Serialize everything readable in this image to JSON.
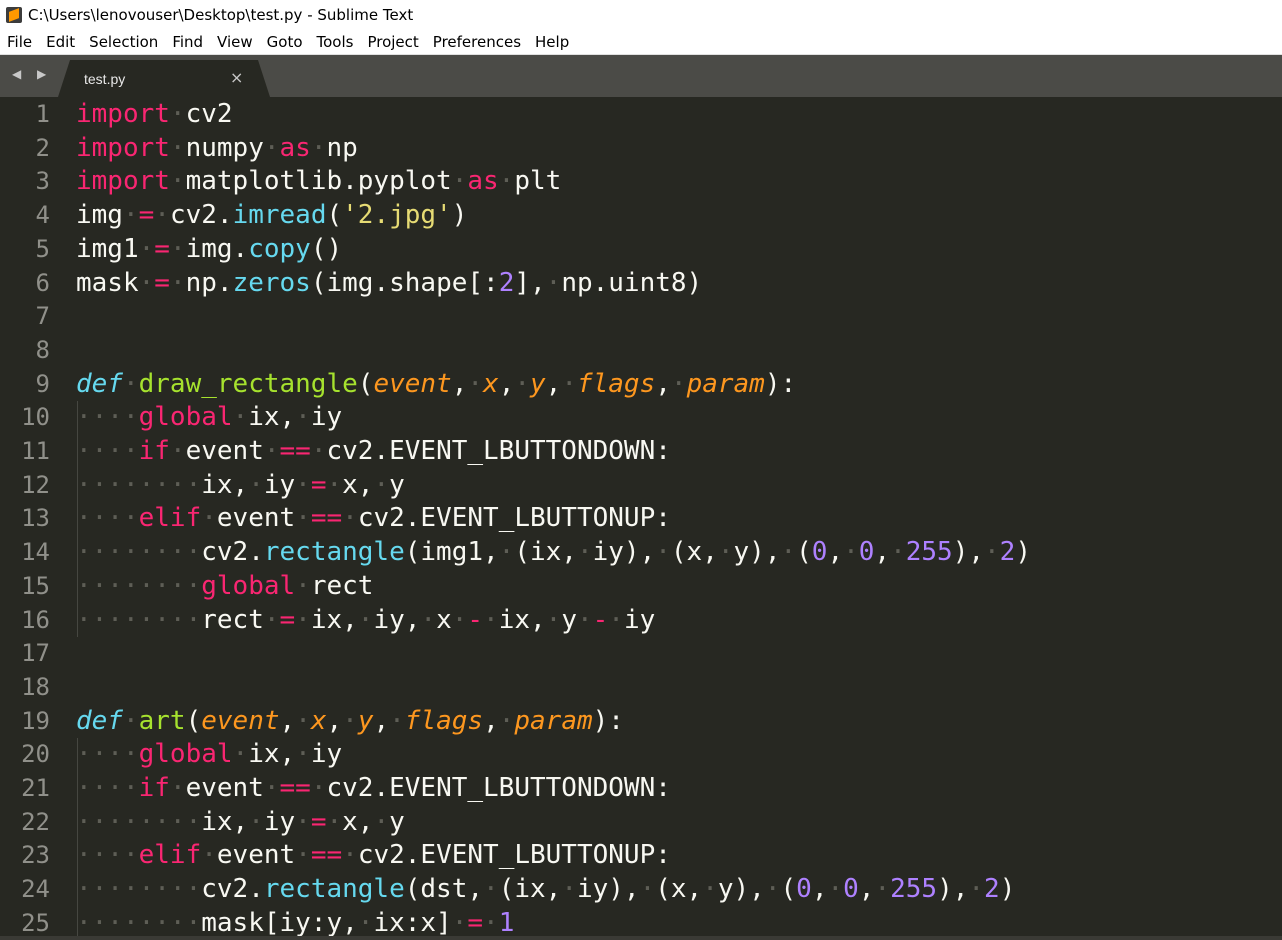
{
  "window": {
    "title": "C:\\Users\\lenovouser\\Desktop\\test.py - Sublime Text"
  },
  "menu": [
    "File",
    "Edit",
    "Selection",
    "Find",
    "View",
    "Goto",
    "Tools",
    "Project",
    "Preferences",
    "Help"
  ],
  "tab": {
    "label": "test.py",
    "close": "×",
    "nav": "◀ ▶"
  },
  "colors": {
    "background": "#272822",
    "keyword": "#f92672",
    "function": "#66d9ef",
    "name": "#a6e22e",
    "parameter": "#fd971f",
    "number": "#ae81ff",
    "string": "#e6db74",
    "whitespace_dot": "#5e5e56"
  },
  "lines": [
    {
      "n": "1",
      "tokens": [
        [
          "kw",
          "import"
        ],
        [
          "ws",
          "·"
        ],
        [
          "plain",
          "cv2"
        ]
      ]
    },
    {
      "n": "2",
      "tokens": [
        [
          "kw",
          "import"
        ],
        [
          "ws",
          "·"
        ],
        [
          "plain",
          "numpy"
        ],
        [
          "ws",
          "·"
        ],
        [
          "kw",
          "as"
        ],
        [
          "ws",
          "·"
        ],
        [
          "plain",
          "np"
        ]
      ]
    },
    {
      "n": "3",
      "tokens": [
        [
          "kw",
          "import"
        ],
        [
          "ws",
          "·"
        ],
        [
          "plain",
          "matplotlib.pyplot"
        ],
        [
          "ws",
          "·"
        ],
        [
          "kw",
          "as"
        ],
        [
          "ws",
          "·"
        ],
        [
          "plain",
          "plt"
        ]
      ]
    },
    {
      "n": "4",
      "tokens": [
        [
          "plain",
          "img"
        ],
        [
          "ws",
          "·"
        ],
        [
          "op",
          "="
        ],
        [
          "ws",
          "·"
        ],
        [
          "plain",
          "cv2."
        ],
        [
          "fn",
          "imread"
        ],
        [
          "plain",
          "("
        ],
        [
          "str",
          "'2.jpg'"
        ],
        [
          "plain",
          ")"
        ]
      ]
    },
    {
      "n": "5",
      "tokens": [
        [
          "plain",
          "img1"
        ],
        [
          "ws",
          "·"
        ],
        [
          "op",
          "="
        ],
        [
          "ws",
          "·"
        ],
        [
          "plain",
          "img."
        ],
        [
          "fn",
          "copy"
        ],
        [
          "plain",
          "()"
        ]
      ]
    },
    {
      "n": "6",
      "tokens": [
        [
          "plain",
          "mask"
        ],
        [
          "ws",
          "·"
        ],
        [
          "op",
          "="
        ],
        [
          "ws",
          "·"
        ],
        [
          "plain",
          "np."
        ],
        [
          "fn",
          "zeros"
        ],
        [
          "plain",
          "(img.shape[:"
        ],
        [
          "num",
          "2"
        ],
        [
          "plain",
          "],"
        ],
        [
          "ws",
          "·"
        ],
        [
          "plain",
          "np.uint8)"
        ]
      ]
    },
    {
      "n": "7",
      "tokens": []
    },
    {
      "n": "8",
      "tokens": []
    },
    {
      "n": "9",
      "tokens": [
        [
          "def",
          "def"
        ],
        [
          "ws",
          "·"
        ],
        [
          "name",
          "draw_rectangle"
        ],
        [
          "plain",
          "("
        ],
        [
          "param",
          "event"
        ],
        [
          "plain",
          ","
        ],
        [
          "ws",
          "·"
        ],
        [
          "param",
          "x"
        ],
        [
          "plain",
          ","
        ],
        [
          "ws",
          "·"
        ],
        [
          "param",
          "y"
        ],
        [
          "plain",
          ","
        ],
        [
          "ws",
          "·"
        ],
        [
          "param",
          "flags"
        ],
        [
          "plain",
          ","
        ],
        [
          "ws",
          "·"
        ],
        [
          "param",
          "param"
        ],
        [
          "plain",
          "):"
        ]
      ]
    },
    {
      "n": "10",
      "tokens": [
        [
          "ws",
          "····"
        ],
        [
          "kw",
          "global"
        ],
        [
          "ws",
          "·"
        ],
        [
          "plain",
          "ix,"
        ],
        [
          "ws",
          "·"
        ],
        [
          "plain",
          "iy"
        ]
      ]
    },
    {
      "n": "11",
      "tokens": [
        [
          "ws",
          "····"
        ],
        [
          "kw",
          "if"
        ],
        [
          "ws",
          "·"
        ],
        [
          "plain",
          "event"
        ],
        [
          "ws",
          "·"
        ],
        [
          "op",
          "=="
        ],
        [
          "ws",
          "·"
        ],
        [
          "plain",
          "cv2.EVENT_LBUTTONDOWN:"
        ]
      ]
    },
    {
      "n": "12",
      "tokens": [
        [
          "ws",
          "········"
        ],
        [
          "plain",
          "ix,"
        ],
        [
          "ws",
          "·"
        ],
        [
          "plain",
          "iy"
        ],
        [
          "ws",
          "·"
        ],
        [
          "op",
          "="
        ],
        [
          "ws",
          "·"
        ],
        [
          "plain",
          "x,"
        ],
        [
          "ws",
          "·"
        ],
        [
          "plain",
          "y"
        ]
      ]
    },
    {
      "n": "13",
      "tokens": [
        [
          "ws",
          "····"
        ],
        [
          "kw",
          "elif"
        ],
        [
          "ws",
          "·"
        ],
        [
          "plain",
          "event"
        ],
        [
          "ws",
          "·"
        ],
        [
          "op",
          "=="
        ],
        [
          "ws",
          "·"
        ],
        [
          "plain",
          "cv2.EVENT_LBUTTONUP:"
        ]
      ]
    },
    {
      "n": "14",
      "tokens": [
        [
          "ws",
          "········"
        ],
        [
          "plain",
          "cv2."
        ],
        [
          "fn",
          "rectangle"
        ],
        [
          "plain",
          "(img1,"
        ],
        [
          "ws",
          "·"
        ],
        [
          "plain",
          "(ix,"
        ],
        [
          "ws",
          "·"
        ],
        [
          "plain",
          "iy),"
        ],
        [
          "ws",
          "·"
        ],
        [
          "plain",
          "(x,"
        ],
        [
          "ws",
          "·"
        ],
        [
          "plain",
          "y),"
        ],
        [
          "ws",
          "·"
        ],
        [
          "plain",
          "("
        ],
        [
          "num",
          "0"
        ],
        [
          "plain",
          ","
        ],
        [
          "ws",
          "·"
        ],
        [
          "num",
          "0"
        ],
        [
          "plain",
          ","
        ],
        [
          "ws",
          "·"
        ],
        [
          "num",
          "255"
        ],
        [
          "plain",
          "),"
        ],
        [
          "ws",
          "·"
        ],
        [
          "num",
          "2"
        ],
        [
          "plain",
          ")"
        ]
      ]
    },
    {
      "n": "15",
      "tokens": [
        [
          "ws",
          "········"
        ],
        [
          "kw",
          "global"
        ],
        [
          "ws",
          "·"
        ],
        [
          "plain",
          "rect"
        ]
      ]
    },
    {
      "n": "16",
      "tokens": [
        [
          "ws",
          "········"
        ],
        [
          "plain",
          "rect"
        ],
        [
          "ws",
          "·"
        ],
        [
          "op",
          "="
        ],
        [
          "ws",
          "·"
        ],
        [
          "plain",
          "ix,"
        ],
        [
          "ws",
          "·"
        ],
        [
          "plain",
          "iy,"
        ],
        [
          "ws",
          "·"
        ],
        [
          "plain",
          "x"
        ],
        [
          "ws",
          "·"
        ],
        [
          "op",
          "-"
        ],
        [
          "ws",
          "·"
        ],
        [
          "plain",
          "ix,"
        ],
        [
          "ws",
          "·"
        ],
        [
          "plain",
          "y"
        ],
        [
          "ws",
          "·"
        ],
        [
          "op",
          "-"
        ],
        [
          "ws",
          "·"
        ],
        [
          "plain",
          "iy"
        ]
      ]
    },
    {
      "n": "17",
      "tokens": []
    },
    {
      "n": "18",
      "tokens": []
    },
    {
      "n": "19",
      "tokens": [
        [
          "def",
          "def"
        ],
        [
          "ws",
          "·"
        ],
        [
          "name",
          "art"
        ],
        [
          "plain",
          "("
        ],
        [
          "param",
          "event"
        ],
        [
          "plain",
          ","
        ],
        [
          "ws",
          "·"
        ],
        [
          "param",
          "x"
        ],
        [
          "plain",
          ","
        ],
        [
          "ws",
          "·"
        ],
        [
          "param",
          "y"
        ],
        [
          "plain",
          ","
        ],
        [
          "ws",
          "·"
        ],
        [
          "param",
          "flags"
        ],
        [
          "plain",
          ","
        ],
        [
          "ws",
          "·"
        ],
        [
          "param",
          "param"
        ],
        [
          "plain",
          "):"
        ]
      ]
    },
    {
      "n": "20",
      "tokens": [
        [
          "ws",
          "····"
        ],
        [
          "kw",
          "global"
        ],
        [
          "ws",
          "·"
        ],
        [
          "plain",
          "ix,"
        ],
        [
          "ws",
          "·"
        ],
        [
          "plain",
          "iy"
        ]
      ]
    },
    {
      "n": "21",
      "tokens": [
        [
          "ws",
          "····"
        ],
        [
          "kw",
          "if"
        ],
        [
          "ws",
          "·"
        ],
        [
          "plain",
          "event"
        ],
        [
          "ws",
          "·"
        ],
        [
          "op",
          "=="
        ],
        [
          "ws",
          "·"
        ],
        [
          "plain",
          "cv2.EVENT_LBUTTONDOWN:"
        ]
      ]
    },
    {
      "n": "22",
      "tokens": [
        [
          "ws",
          "········"
        ],
        [
          "plain",
          "ix,"
        ],
        [
          "ws",
          "·"
        ],
        [
          "plain",
          "iy"
        ],
        [
          "ws",
          "·"
        ],
        [
          "op",
          "="
        ],
        [
          "ws",
          "·"
        ],
        [
          "plain",
          "x,"
        ],
        [
          "ws",
          "·"
        ],
        [
          "plain",
          "y"
        ]
      ]
    },
    {
      "n": "23",
      "tokens": [
        [
          "ws",
          "····"
        ],
        [
          "kw",
          "elif"
        ],
        [
          "ws",
          "·"
        ],
        [
          "plain",
          "event"
        ],
        [
          "ws",
          "·"
        ],
        [
          "op",
          "=="
        ],
        [
          "ws",
          "·"
        ],
        [
          "plain",
          "cv2.EVENT_LBUTTONUP:"
        ]
      ]
    },
    {
      "n": "24",
      "tokens": [
        [
          "ws",
          "········"
        ],
        [
          "plain",
          "cv2."
        ],
        [
          "fn",
          "rectangle"
        ],
        [
          "plain",
          "(dst,"
        ],
        [
          "ws",
          "·"
        ],
        [
          "plain",
          "(ix,"
        ],
        [
          "ws",
          "·"
        ],
        [
          "plain",
          "iy),"
        ],
        [
          "ws",
          "·"
        ],
        [
          "plain",
          "(x,"
        ],
        [
          "ws",
          "·"
        ],
        [
          "plain",
          "y),"
        ],
        [
          "ws",
          "·"
        ],
        [
          "plain",
          "("
        ],
        [
          "num",
          "0"
        ],
        [
          "plain",
          ","
        ],
        [
          "ws",
          "·"
        ],
        [
          "num",
          "0"
        ],
        [
          "plain",
          ","
        ],
        [
          "ws",
          "·"
        ],
        [
          "num",
          "255"
        ],
        [
          "plain",
          "),"
        ],
        [
          "ws",
          "·"
        ],
        [
          "num",
          "2"
        ],
        [
          "plain",
          ")"
        ]
      ]
    },
    {
      "n": "25",
      "tokens": [
        [
          "ws",
          "········"
        ],
        [
          "plain",
          "mask[iy:y,"
        ],
        [
          "ws",
          "·"
        ],
        [
          "plain",
          "ix:x]"
        ],
        [
          "ws",
          "·"
        ],
        [
          "op",
          "="
        ],
        [
          "ws",
          "·"
        ],
        [
          "num",
          "1"
        ]
      ]
    }
  ]
}
